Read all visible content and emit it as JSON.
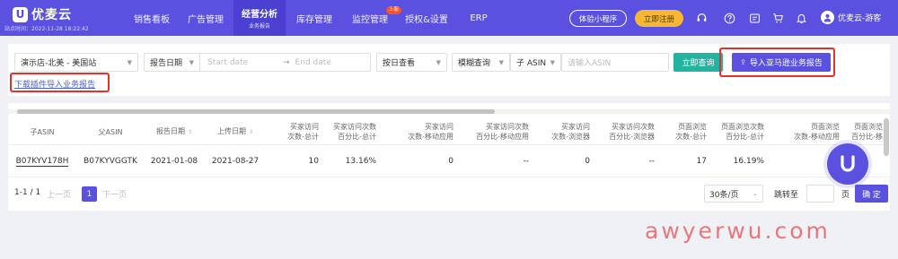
{
  "nav": {
    "logo_text": "优麦云",
    "site_info": "站点时间：2022-11-28 18:22:42",
    "items": [
      {
        "label": "销售看板",
        "sub": ""
      },
      {
        "label": "广告管理",
        "sub": ""
      },
      {
        "label": "经营分析",
        "sub": "业务报告"
      },
      {
        "label": "库存管理",
        "sub": ""
      },
      {
        "label": "监控管理",
        "sub": "",
        "badge": "上新"
      },
      {
        "label": "授权&设置",
        "sub": ""
      },
      {
        "label": "ERP",
        "sub": ""
      }
    ],
    "trial_label": "体验小程序",
    "register_label": "立即注册",
    "user_name": "优麦云-游客",
    "accent_color": "#5b51e0"
  },
  "filters": {
    "store": "演示店-北美 - 美国站",
    "date_type": "报告日期",
    "start_placeholder": "Start date",
    "end_placeholder": "End date",
    "view_by": "按日查看",
    "match_mode": "模糊查询",
    "asin_type": "子 ASIN",
    "asin_placeholder": "请输入ASIN",
    "query_button": "立即查询",
    "import_button": "导入亚马逊业务报告",
    "download_link": "下载插件导入业务报告"
  },
  "table": {
    "headers": [
      [
        "子ASIN"
      ],
      [
        "父ASIN"
      ],
      [
        "报告日期"
      ],
      [
        "上传日期"
      ],
      [
        "买家访问",
        "次数-总计"
      ],
      [
        "买家访问次数",
        "百分比-总计"
      ],
      [
        "买家访问",
        "次数-移动应用"
      ],
      [
        "买家访问次数",
        "百分比-移动应用"
      ],
      [
        "买家访问",
        "次数-浏览器"
      ],
      [
        "买家访问次数",
        "百分比-浏览器"
      ],
      [
        "页面浏览",
        "次数-总计"
      ],
      [
        "页面浏览次数",
        "百分比-总计"
      ],
      [
        "页面浏览",
        "次数-移动应用"
      ],
      [
        "页面浏览",
        "百分比-移"
      ]
    ],
    "rows": [
      [
        "B07KYV178H",
        "B07KYVGGTK",
        "2021-01-08",
        "2021-08-27",
        "10",
        "13.16%",
        "0",
        "--",
        "0",
        "--",
        "17",
        "16.19%",
        "",
        ""
      ]
    ]
  },
  "pagination": {
    "summary": "1-1 / 1",
    "prev": "上一页",
    "current_page": "1",
    "next": "下一页",
    "page_size": "30条/页",
    "jump_label": "跳转至",
    "page_unit": "页",
    "confirm": "确 定"
  },
  "watermark": "awyerwu.com"
}
